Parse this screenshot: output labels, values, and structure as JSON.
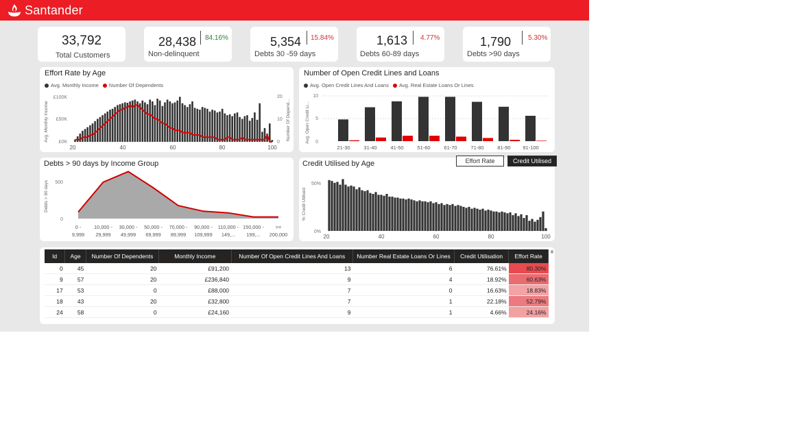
{
  "brand": {
    "name": "Santander",
    "color": "#ec1d24"
  },
  "kpis": [
    {
      "value": "33,792",
      "label": "Total Customers",
      "pct": ""
    },
    {
      "value": "28,438",
      "label": "Non-delinquent",
      "pct": "84.16%",
      "pct_color": "#2e7d32"
    },
    {
      "value": "5,354",
      "label": "Debts 30 -59 days",
      "pct": "15.84%",
      "pct_color": "#d32f2f"
    },
    {
      "value": "1,613",
      "label": "Debts 60-89 days",
      "pct": "4.77%",
      "pct_color": "#d32f2f"
    },
    {
      "value": "1,790",
      "label": "Debts >90 days",
      "pct": "5.30%",
      "pct_color": "#d32f2f"
    }
  ],
  "effort": {
    "title": "Effort Rate by Age",
    "legend": [
      "Avg. Monthly Income",
      "Number Of Dependents"
    ],
    "ylabel_left": "Avg. Monthly Income",
    "ylabel_right": "Number Of Depend...",
    "yticks_left": [
      "£100K",
      "£50K",
      "£0K"
    ],
    "yticks_right": [
      "20",
      "10",
      "0"
    ],
    "xticks": [
      "20",
      "40",
      "60",
      "80",
      "100"
    ]
  },
  "openlines": {
    "title": "Number of Open Credit Lines and Loans",
    "legend": [
      "Avg. Open Credit Lines And Loans",
      "Avg. Real Estate Loans Or Lines"
    ],
    "ylabel": "Avg. Open Credit Li...",
    "yticks": [
      "10",
      "5",
      "0"
    ]
  },
  "debts90": {
    "title": "Debts > 90 days by Income Group",
    "ylabel": "Debts > 90 days",
    "yticks": [
      "500",
      "0"
    ]
  },
  "utilised": {
    "title": "Credit Utilised by Age",
    "ylabel": "% Credit Utilised",
    "yticks": [
      "50%",
      "0%"
    ],
    "xticks": [
      "20",
      "40",
      "60",
      "80",
      "100"
    ],
    "toggle_effort": "Effort Rate",
    "toggle_credit": "Credit Utilised"
  },
  "table": {
    "headers": [
      "Id",
      "Age",
      "Number Of Dependents",
      "Monthly Income",
      "Number Of Open Credit Lines And Loans",
      "Number Real Estate Loans Or Lines",
      "Credit Utilisation",
      "Effort Rate"
    ],
    "rows": [
      [
        "0",
        "45",
        "20",
        "£91,200",
        "13",
        "6",
        "76.61%",
        "80.30%"
      ],
      [
        "9",
        "57",
        "20",
        "£236,840",
        "9",
        "4",
        "18.92%",
        "60.63%"
      ],
      [
        "17",
        "53",
        "0",
        "£88,000",
        "7",
        "0",
        "16.63%",
        "18.83%"
      ],
      [
        "18",
        "43",
        "20",
        "£32,800",
        "7",
        "1",
        "22.18%",
        "52.79%"
      ],
      [
        "24",
        "58",
        "0",
        "£24,160",
        "9",
        "1",
        "4.66%",
        "24.16%"
      ]
    ]
  },
  "chart_data": [
    {
      "type": "bar",
      "title": "Effort Rate by Age",
      "xlabel": "",
      "ylabel": "Avg. Monthly Income",
      "x": [
        21,
        22,
        23,
        24,
        25,
        26,
        27,
        28,
        29,
        30,
        31,
        32,
        33,
        34,
        35,
        36,
        37,
        38,
        39,
        40,
        41,
        42,
        43,
        44,
        45,
        46,
        47,
        48,
        49,
        50,
        51,
        52,
        53,
        54,
        55,
        56,
        57,
        58,
        59,
        60,
        61,
        62,
        63,
        64,
        65,
        66,
        67,
        68,
        69,
        70,
        71,
        72,
        73,
        74,
        75,
        76,
        77,
        78,
        79,
        80,
        81,
        82,
        83,
        84,
        85,
        86,
        87,
        88,
        89,
        90,
        91,
        92,
        93,
        94,
        95,
        96,
        97,
        98,
        99,
        100
      ],
      "series": [
        {
          "name": "Avg. Monthly Income",
          "axis": "left",
          "values": [
            5,
            12,
            18,
            24,
            28,
            32,
            36,
            40,
            45,
            50,
            54,
            58,
            62,
            66,
            70,
            72,
            76,
            80,
            82,
            84,
            86,
            85,
            88,
            90,
            92,
            88,
            84,
            90,
            86,
            82,
            92,
            88,
            80,
            94,
            90,
            78,
            86,
            92,
            88,
            84,
            86,
            90,
            98,
            84,
            80,
            76,
            82,
            88,
            74,
            72,
            70,
            76,
            74,
            72,
            66,
            70,
            68,
            64,
            66,
            72,
            62,
            58,
            60,
            56,
            62,
            64,
            54,
            50,
            56,
            58,
            46,
            52,
            64,
            48,
            84,
            22,
            30,
            18,
            40,
            4
          ],
          "ylim": [
            0,
            115
          ]
        },
        {
          "name": "Number Of Dependents",
          "axis": "right",
          "values": [
            1,
            1,
            1,
            2,
            2,
            2,
            3,
            3,
            4,
            5,
            6,
            7,
            8,
            9,
            10,
            11,
            12,
            13,
            14,
            14,
            15,
            15,
            16,
            15,
            16,
            16,
            15,
            14,
            13,
            12,
            12,
            11,
            10,
            10,
            9,
            8,
            8,
            7,
            6,
            6,
            5,
            5,
            5,
            4,
            4,
            4,
            4,
            3,
            3,
            3,
            3,
            2,
            2,
            2,
            2,
            2,
            2,
            1,
            1,
            1,
            1,
            2,
            2,
            1,
            1,
            1,
            1,
            2,
            1,
            1,
            1,
            1,
            1,
            1,
            1,
            1,
            1,
            3,
            0,
            0
          ],
          "ylim": [
            0,
            21
          ]
        }
      ]
    },
    {
      "type": "bar",
      "title": "Number of Open Credit Lines and Loans",
      "categories": [
        "21-30",
        "31-40",
        "41-50",
        "51-60",
        "61-70",
        "71-80",
        "81-90",
        "91-100"
      ],
      "ylabel": "Avg. Open Credit Li...",
      "ylim": [
        0,
        10
      ],
      "series": [
        {
          "name": "Avg. Open Credit Lines And Loans",
          "values": [
            4.8,
            7.5,
            8.8,
            9.8,
            9.8,
            8.7,
            7.6,
            5.6
          ]
        },
        {
          "name": "Avg. Real Estate Loans Or Lines",
          "values": [
            0.2,
            0.8,
            1.2,
            1.2,
            1.0,
            0.7,
            0.3,
            0.1
          ]
        }
      ]
    },
    {
      "type": "area",
      "title": "Debts > 90 days by Income Group",
      "ylabel": "Debts > 90 days",
      "ylim": [
        0,
        600
      ],
      "categories": [
        "0 - 9,999",
        "10,000 - 29,999",
        "30,000 - 49,999",
        "50,000 - 69,999",
        "70,000 - 89,999",
        "90,000 - 109,999",
        "110,000 - 149,...",
        "150,000 - 199,...",
        ">= 200,000"
      ],
      "values": [
        80,
        450,
        580,
        380,
        160,
        90,
        70,
        20,
        20
      ]
    },
    {
      "type": "bar",
      "title": "Credit Utilised by Age",
      "ylabel": "% Credit Utilised",
      "ylim": [
        0,
        60
      ],
      "x": [
        21,
        22,
        23,
        24,
        25,
        26,
        27,
        28,
        29,
        30,
        31,
        32,
        33,
        34,
        35,
        36,
        37,
        38,
        39,
        40,
        41,
        42,
        43,
        44,
        45,
        46,
        47,
        48,
        49,
        50,
        51,
        52,
        53,
        54,
        55,
        56,
        57,
        58,
        59,
        60,
        61,
        62,
        63,
        64,
        65,
        66,
        67,
        68,
        69,
        70,
        71,
        72,
        73,
        74,
        75,
        76,
        77,
        78,
        79,
        80,
        81,
        82,
        83,
        84,
        85,
        86,
        87,
        88,
        89,
        90,
        91,
        92,
        93,
        94,
        95,
        96,
        97,
        98,
        99,
        100
      ],
      "values": [
        55,
        54,
        52,
        53,
        50,
        56,
        50,
        48,
        49,
        48,
        45,
        47,
        44,
        43,
        44,
        41,
        40,
        42,
        39,
        39,
        38,
        40,
        37,
        37,
        36,
        36,
        35,
        35,
        34,
        35,
        34,
        33,
        32,
        33,
        32,
        32,
        31,
        32,
        30,
        31,
        29,
        30,
        28,
        29,
        28,
        29,
        27,
        28,
        27,
        26,
        25,
        26,
        24,
        25,
        24,
        23,
        24,
        22,
        23,
        22,
        21,
        21,
        20,
        21,
        20,
        19,
        20,
        17,
        19,
        16,
        18,
        14,
        17,
        11,
        13,
        10,
        12,
        15,
        21,
        3
      ]
    }
  ]
}
